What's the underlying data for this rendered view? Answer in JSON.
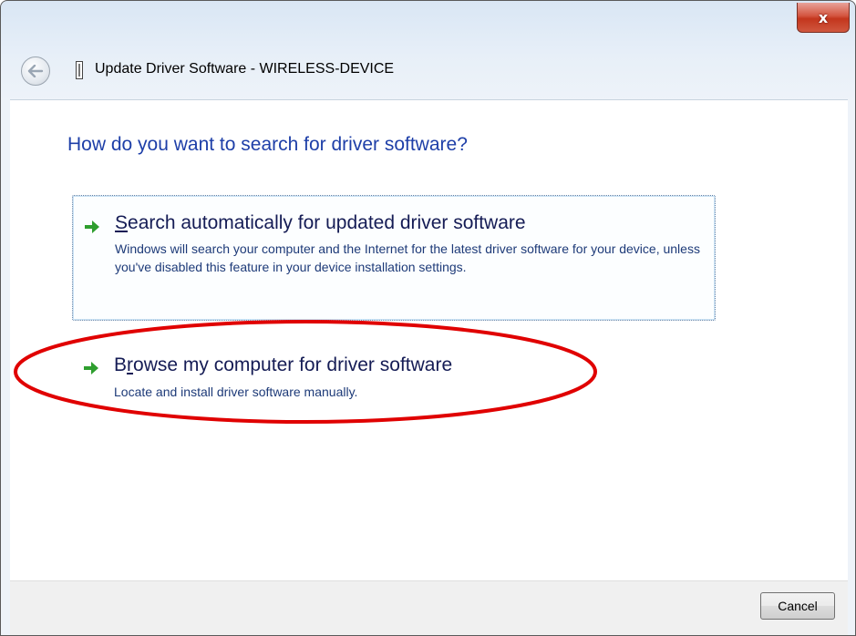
{
  "window": {
    "title": "Update Driver Software - WIRELESS-DEVICE",
    "close_label": "x"
  },
  "main": {
    "heading": "How do you want to search for driver software?",
    "options": [
      {
        "title": "Search automatically for updated driver software",
        "description": "Windows will search your computer and the Internet for the latest driver software for your device, unless you've disabled this feature in your device installation settings."
      },
      {
        "title_prefix": "B",
        "title_accesskey": "r",
        "title_rest": "owse my computer for driver software",
        "description": "Locate and install driver software manually."
      }
    ]
  },
  "footer": {
    "cancel_label": "Cancel"
  },
  "icons": {
    "back": "back-arrow-icon",
    "device": "device-icon",
    "option_arrow": "green-arrow-icon"
  },
  "colors": {
    "heading": "#1e3fa8",
    "link_title": "#151c55",
    "link_desc": "#1d3a78",
    "annotation": "#e00000",
    "arrow": "#2e9e2e"
  }
}
